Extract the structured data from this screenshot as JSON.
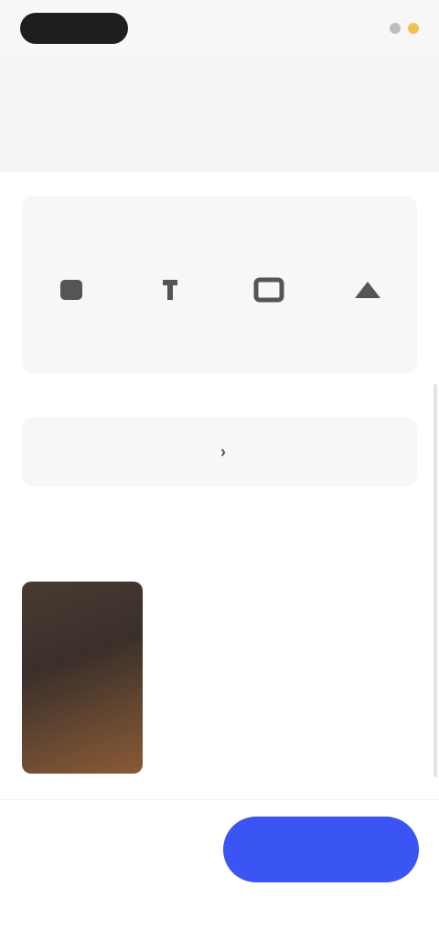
{
  "status": {
    "time_pill": "",
    "right_text": "",
    "icons": [
      "signal-icon",
      "battery-icon"
    ]
  },
  "description": {
    "text": "",
    "more_label": ""
  },
  "rating": {
    "title": "",
    "metrics": [
      {
        "icon": "metric-1-icon",
        "label": ""
      },
      {
        "icon": "metric-2-icon",
        "label": ""
      },
      {
        "icon": "metric-3-icon",
        "label": ""
      },
      {
        "icon": "metric-4-icon",
        "label": ""
      }
    ]
  },
  "cta": {
    "label": "",
    "chevron": "›"
  },
  "photos": {
    "title": ""
  },
  "bottom": {
    "left_label": "",
    "primary_label": ""
  },
  "colors": {
    "primary": "#3b55f5",
    "surface": "#f7f7f7"
  }
}
